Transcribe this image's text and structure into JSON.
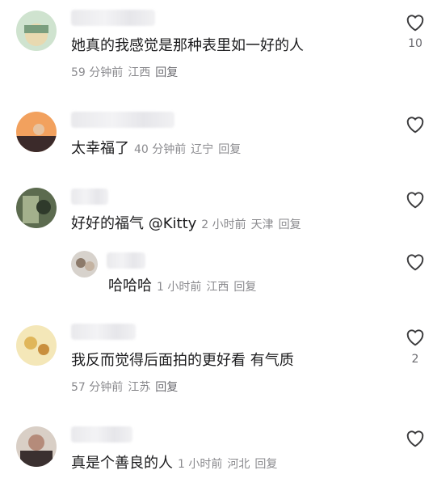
{
  "comments": [
    {
      "text": "她真的我感觉是那种表里如一好的人",
      "time": "59 分钟前",
      "location": "江西",
      "reply": "回复",
      "likes": "10",
      "avatar_colors": [
        "#cfe3cf",
        "#e8d9b0",
        "#7a9e7e"
      ]
    },
    {
      "text": "太幸福了",
      "time": "40 分钟前",
      "location": "辽宁",
      "reply": "回复",
      "likes": "",
      "avatar_colors": [
        "#f2a15e",
        "#3b2a2a",
        "#e7c3a0"
      ]
    },
    {
      "text": "好好的福气 @Kitty",
      "time": "2 小时前",
      "location": "天津",
      "reply": "回复",
      "likes": "",
      "avatar_colors": [
        "#5c6b4f",
        "#a3b08c",
        "#2f3a2b"
      ]
    },
    {
      "text": "哈哈哈",
      "time": "1 小时前",
      "location": "江西",
      "reply": "回复",
      "likes": "",
      "avatar_colors": [
        "#d7d2cc",
        "#8c7a6a",
        "#c4b3a2"
      ]
    },
    {
      "text": "我反而觉得后面拍的更好看 有气质",
      "time": "57 分钟前",
      "location": "江苏",
      "reply": "回复",
      "likes": "2",
      "avatar_colors": [
        "#f4e7b8",
        "#e0b65a",
        "#c98f3e"
      ]
    },
    {
      "text": "真是个善良的人",
      "time": "1 小时前",
      "location": "河北",
      "reply": "回复",
      "likes": "",
      "avatar_colors": [
        "#d9cfc6",
        "#3a3030",
        "#b58b7a"
      ]
    }
  ],
  "icons": {
    "like": "heart-outline-icon"
  }
}
